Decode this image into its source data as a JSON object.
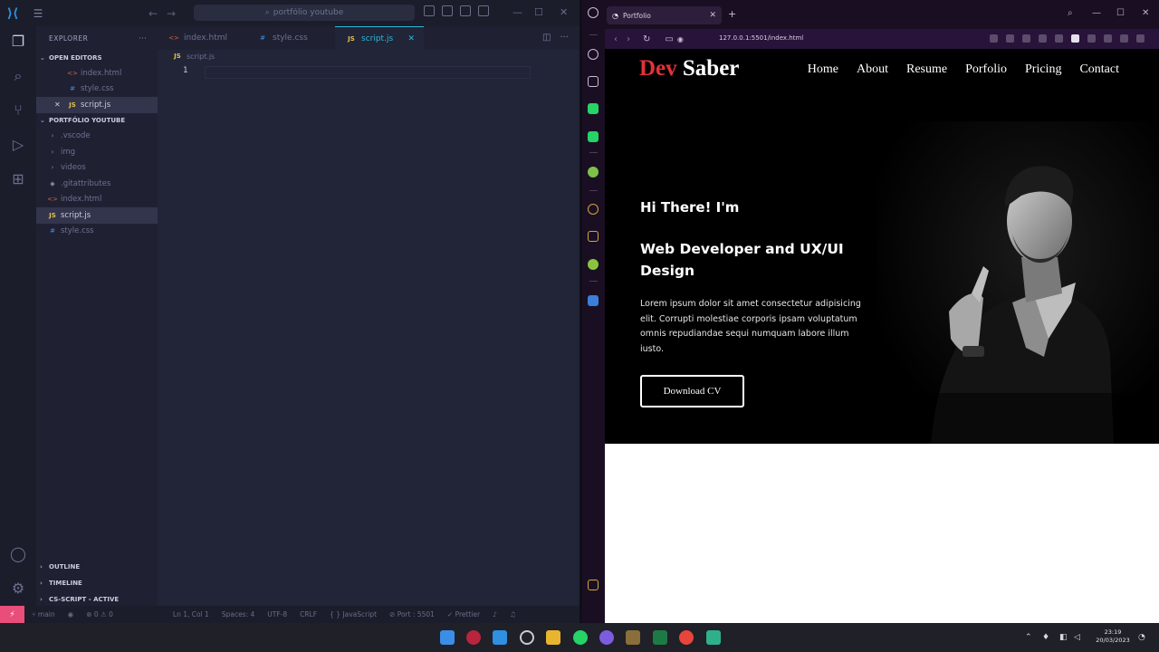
{
  "vscode": {
    "search_text": "portfólio youtube",
    "explorer_title": "EXPLORER",
    "open_editors_title": "OPEN EDITORS",
    "open_editors": [
      {
        "name": "index.html",
        "type": "html"
      },
      {
        "name": "style.css",
        "type": "css"
      },
      {
        "name": "script.js",
        "type": "js"
      }
    ],
    "project_title": "PORTFÓLIO YOUTUBE",
    "files": [
      {
        "name": ".vscode",
        "type": "dir"
      },
      {
        "name": "img",
        "type": "dir"
      },
      {
        "name": "videos",
        "type": "dir"
      },
      {
        "name": ".gitattributes",
        "type": "git"
      },
      {
        "name": "index.html",
        "type": "html"
      },
      {
        "name": "script.js",
        "type": "js"
      },
      {
        "name": "style.css",
        "type": "css"
      }
    ],
    "bottom_sections": [
      "OUTLINE",
      "TIMELINE",
      "CS-SCRIPT - ACTIVE"
    ],
    "tabs": [
      {
        "label": "index.html",
        "type": "html"
      },
      {
        "label": "style.css",
        "type": "css"
      },
      {
        "label": "script.js",
        "type": "js"
      }
    ],
    "breadcrumb": "script.js",
    "line_number": "1",
    "status": {
      "branch": "main",
      "problems": "⊗ 0 ⚠ 0",
      "position": "Ln 1, Col 1",
      "spaces": "Spaces: 4",
      "encoding": "UTF-8",
      "eol": "CRLF",
      "language": "JavaScript",
      "port": "Port : 5501",
      "formatter": "Prettier"
    }
  },
  "browser": {
    "tab_title": "Portfolio",
    "url": "127.0.0.1:5501/index.html"
  },
  "site": {
    "logo_accent": "Dev",
    "logo_rest": "Saber",
    "nav": [
      "Home",
      "About",
      "Resume",
      "Porfolio",
      "Pricing",
      "Contact"
    ],
    "greeting": "Hi There! I'm",
    "title": "Web Developer and UX/UI Design",
    "text": "Lorem ipsum dolor sit amet consectetur adipisicing elit. Corrupti molestiae corporis ipsam voluptatum omnis repudiandae sequi numquam labore illum iusto.",
    "button": "Download CV",
    "accent_color": "#e23238"
  },
  "taskbar": {
    "time": "23:19",
    "date": "20/03/2023"
  }
}
